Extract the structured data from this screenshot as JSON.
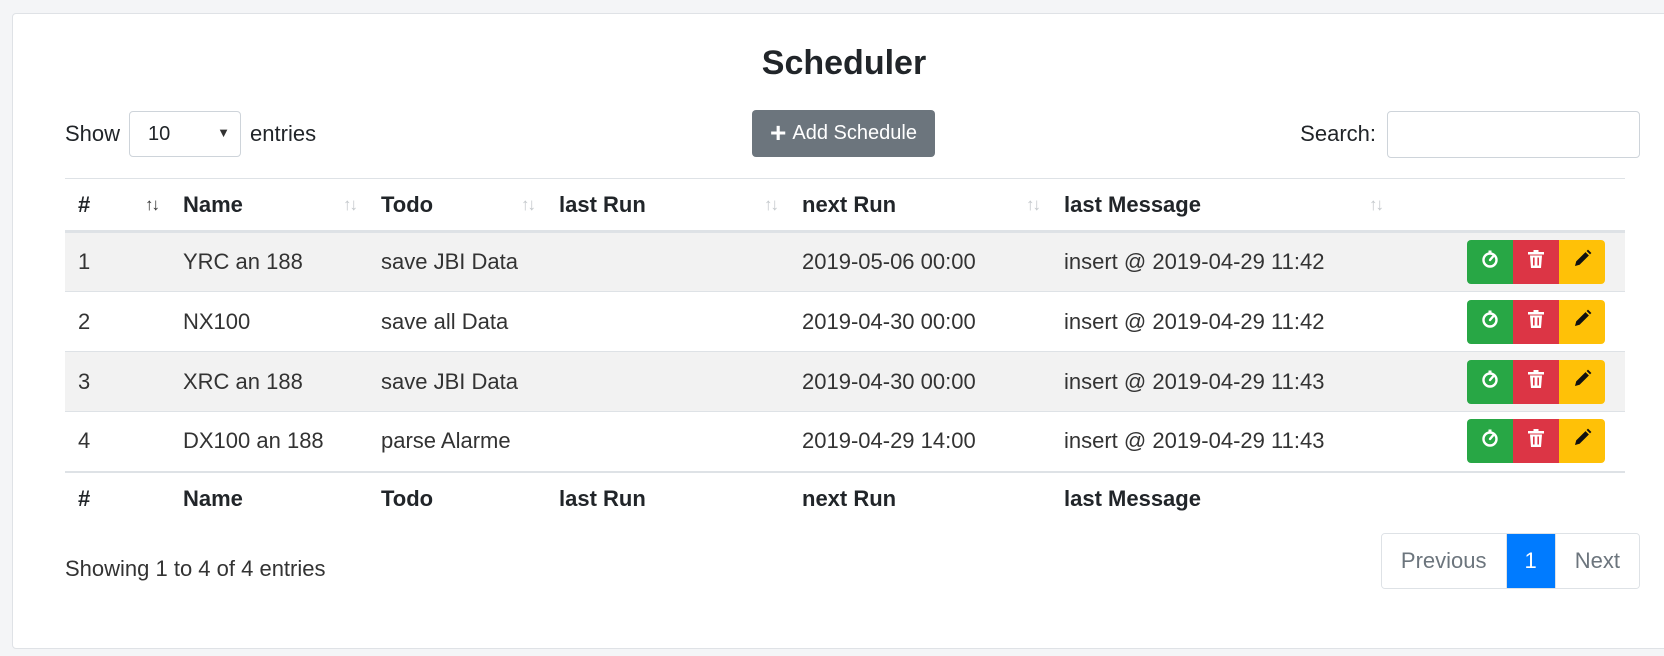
{
  "title": "Scheduler",
  "length_menu": {
    "prefix": "Show",
    "value": "10",
    "suffix": "entries"
  },
  "add_button_label": "Add Schedule",
  "search": {
    "label": "Search:",
    "value": "",
    "placeholder": ""
  },
  "columns": [
    "#",
    "Name",
    "Todo",
    "last Run",
    "next Run",
    "last Message"
  ],
  "rows": [
    {
      "id": "1",
      "name": "YRC an 188",
      "todo": "save JBI Data",
      "last_run": "",
      "next_run": "2019-05-06 00:00",
      "last_message": "insert @ 2019-04-29 11:42"
    },
    {
      "id": "2",
      "name": "NX100",
      "todo": "save all Data",
      "last_run": "",
      "next_run": "2019-04-30 00:00",
      "last_message": "insert @ 2019-04-29 11:42"
    },
    {
      "id": "3",
      "name": "XRC an 188",
      "todo": "save JBI Data",
      "last_run": "",
      "next_run": "2019-04-30 00:00",
      "last_message": "insert @ 2019-04-29 11:43"
    },
    {
      "id": "4",
      "name": "DX100 an 188",
      "todo": "parse Alarme",
      "last_run": "",
      "next_run": "2019-04-29 14:00",
      "last_message": "insert @ 2019-04-29 11:43"
    }
  ],
  "row_actions": {
    "run": {
      "icon": "timer-icon",
      "color": "#28a745"
    },
    "delete": {
      "icon": "trash-icon",
      "color": "#dc3545"
    },
    "edit": {
      "icon": "pencil-icon",
      "color": "#ffc107"
    }
  },
  "info_text": "Showing 1 to 4 of 4 entries",
  "pagination": {
    "previous": "Previous",
    "current": "1",
    "next": "Next"
  },
  "colors": {
    "primary": "#007bff",
    "secondary": "#6c757d"
  }
}
